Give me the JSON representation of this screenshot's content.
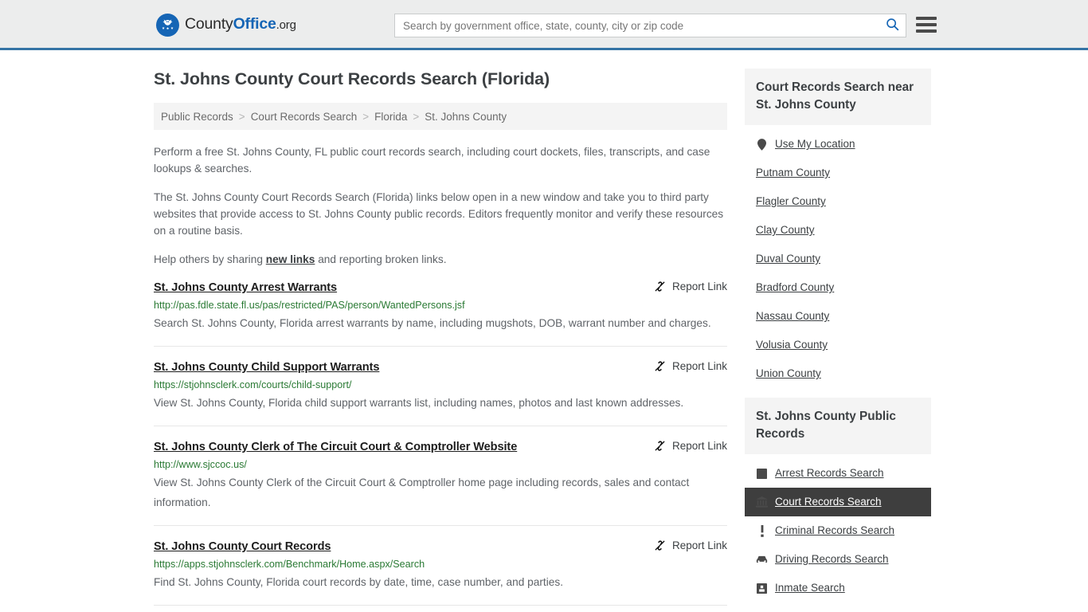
{
  "site": {
    "logo_text_1": "County",
    "logo_text_2": "Office",
    "logo_text_3": ".org",
    "logo_icon": "eagle-stars-emblem"
  },
  "search": {
    "placeholder": "Search by government office, state, county, city or zip code",
    "value": "",
    "icon": "search-icon",
    "menu_icon": "hamburger-menu-icon"
  },
  "page": {
    "title": "St. Johns County Court Records Search (Florida)"
  },
  "breadcrumb": {
    "separator": ">",
    "items": [
      {
        "label": "Public Records"
      },
      {
        "label": "Court Records Search"
      },
      {
        "label": "Florida"
      },
      {
        "label": "St. Johns County"
      }
    ]
  },
  "intro": {
    "p1": "Perform a free St. Johns County, FL public court records search, including court dockets, files, transcripts, and case lookups & searches.",
    "p2": "The St. Johns County Court Records Search (Florida) links below open in a new window and take you to third party websites that provide access to St. Johns County public records. Editors frequently monitor and verify these resources on a routine basis.",
    "p3_before": "Help others by sharing ",
    "p3_link": "new links",
    "p3_after": " and reporting broken links."
  },
  "results": {
    "report_label": "Report Link",
    "report_icon": "broken-link-icon",
    "items": [
      {
        "title": "St. Johns County Arrest Warrants",
        "url": "http://pas.fdle.state.fl.us/pas/restricted/PAS/person/WantedPersons.jsf",
        "description": "Search St. Johns County, Florida arrest warrants by name, including mugshots, DOB, warrant number and charges."
      },
      {
        "title": "St. Johns County Child Support Warrants",
        "url": "https://stjohnsclerk.com/courts/child-support/",
        "description": "View St. Johns County, Florida child support warrants list, including names, photos and last known addresses."
      },
      {
        "title": "St. Johns County Clerk of The Circuit Court & Comptroller Website",
        "url": "http://www.sjccoc.us/",
        "description": "View St. Johns County Clerk of the Circuit Court & Comptroller home page including records, sales and contact information."
      },
      {
        "title": "St. Johns County Court Records",
        "url": "https://apps.stjohnsclerk.com/Benchmark/Home.aspx/Search",
        "description": "Find St. Johns County, Florida court records by date, time, case number, and parties."
      }
    ]
  },
  "sidebar": {
    "nearby": {
      "heading": "Court Records Search near St. Johns County",
      "items": [
        {
          "label": "Use My Location",
          "icon": "map-pin-icon"
        },
        {
          "label": "Putnam County",
          "icon": ""
        },
        {
          "label": "Flagler County",
          "icon": ""
        },
        {
          "label": "Clay County",
          "icon": ""
        },
        {
          "label": "Duval County",
          "icon": ""
        },
        {
          "label": "Bradford County",
          "icon": ""
        },
        {
          "label": "Nassau County",
          "icon": ""
        },
        {
          "label": "Volusia County",
          "icon": ""
        },
        {
          "label": "Union County",
          "icon": ""
        }
      ]
    },
    "public_records": {
      "heading": "St. Johns County Public Records",
      "items": [
        {
          "label": "Arrest Records Search",
          "icon": "fingerprint-icon",
          "active": false
        },
        {
          "label": "Court Records Search",
          "icon": "courthouse-icon",
          "active": true
        },
        {
          "label": "Criminal Records Search",
          "icon": "exclamation-icon",
          "active": false
        },
        {
          "label": "Driving Records Search",
          "icon": "car-icon",
          "active": false
        },
        {
          "label": "Inmate Search",
          "icon": "inmate-icon",
          "active": false
        }
      ]
    }
  },
  "colors": {
    "header_bg": "#eceded",
    "header_border": "#3574a5",
    "brand_blue": "#1565b5",
    "url_green": "#2a7a34",
    "active_bg": "#3e3e3e",
    "panel_bg": "#f4f4f4"
  }
}
